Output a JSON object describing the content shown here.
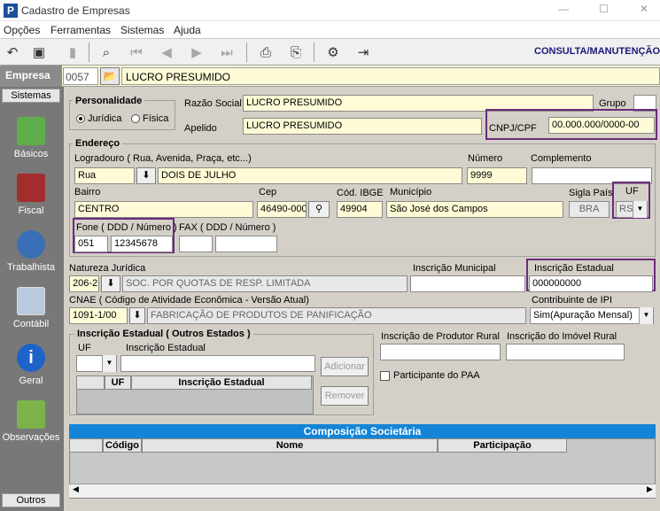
{
  "window": {
    "title": "Cadastro de Empresas",
    "app_letter": "P"
  },
  "menu": [
    "Opções",
    "Ferramentas",
    "Sistemas",
    "Ajuda"
  ],
  "toolbar": {
    "mode_label": "CONSULTA/MANUTENÇÃO"
  },
  "company": {
    "label": "Empresa",
    "code": "0057",
    "name": "LUCRO PRESUMIDO"
  },
  "sidebar": {
    "header": "Sistemas",
    "footer": "Outros",
    "items": [
      {
        "label": "Básicos",
        "icon": "notebook-icon"
      },
      {
        "label": "Fiscal",
        "icon": "book-icon"
      },
      {
        "label": "Trabalhista",
        "icon": "worker-icon"
      },
      {
        "label": "Contábil",
        "icon": "calculator-icon"
      },
      {
        "label": "Geral",
        "icon": "info-icon"
      },
      {
        "label": "Observações",
        "icon": "notepad-pen-icon"
      }
    ]
  },
  "personalidade": {
    "title": "Personalidade",
    "options": [
      "Jurídica",
      "Física"
    ],
    "selected": "Jurídica"
  },
  "razao_social": {
    "label": "Razão Social",
    "value": "LUCRO PRESUMIDO"
  },
  "grupo": {
    "label": "Grupo",
    "value": ""
  },
  "apelido": {
    "label": "Apelido",
    "value": "LUCRO PRESUMIDO"
  },
  "cnpj": {
    "label": "CNPJ/CPF",
    "value": "00.000.000/0000-00"
  },
  "endereco": {
    "title": "Endereço",
    "logradouro_label": "Logradouro ( Rua, Avenida, Praça, etc...)",
    "tipo": "Rua",
    "logradouro": "DOIS DE JULHO",
    "numero_label": "Número",
    "numero": "9999",
    "complemento_label": "Complemento",
    "complemento": "",
    "bairro_label": "Bairro",
    "bairro": "CENTRO",
    "cep_label": "Cep",
    "cep": "46490-000",
    "ibge_label": "Cód. IBGE",
    "ibge": "49904",
    "municipio_label": "Município",
    "municipio": "São José dos Campos",
    "pais_label": "Sigla País",
    "pais": "BRA",
    "uf_label": "UF",
    "uf": "RS",
    "fone_label": "Fone ( DDD / Número )",
    "fone_ddd": "051",
    "fone_numero": "12345678",
    "fax_label": "FAX ( DDD / Número )",
    "fax_ddd": "",
    "fax_numero": ""
  },
  "natureza": {
    "label": "Natureza Jurídica",
    "code": "206-2",
    "desc": "SOC. POR QUOTAS DE RESP. LIMITADA"
  },
  "insc_municipal": {
    "label": "Inscrição Municipal",
    "value": ""
  },
  "insc_estadual": {
    "label": "Inscrição Estadual",
    "value": "000000000"
  },
  "cnae": {
    "label": "CNAE ( Código de Atividade Econômica - Versão Atual)",
    "code": "1091-1/00",
    "desc": "FABRICAÇÃO DE PRODUTOS DE PANIFICAÇÃO"
  },
  "ipi": {
    "label": "Contribuinte de IPI",
    "value": "Sim(Apuração Mensal)"
  },
  "outros_estados": {
    "title": "Inscrição Estadual ( Outros Estados )",
    "uf_label": "UF",
    "ie_label": "Inscrição Estadual",
    "add_button": "Adicionar",
    "remove_button": "Remover",
    "columns": [
      "UF",
      "Inscrição Estadual"
    ]
  },
  "produtor_rural": {
    "label": "Inscrição de Produtor Rural",
    "value": ""
  },
  "imovel_rural": {
    "label": "Inscrição do Imóvel Rural",
    "value": ""
  },
  "paa": {
    "label": "Participante do PAA"
  },
  "composicao": {
    "title": "Composição Societária",
    "columns": [
      "Código",
      "Nome",
      "Participação"
    ]
  }
}
